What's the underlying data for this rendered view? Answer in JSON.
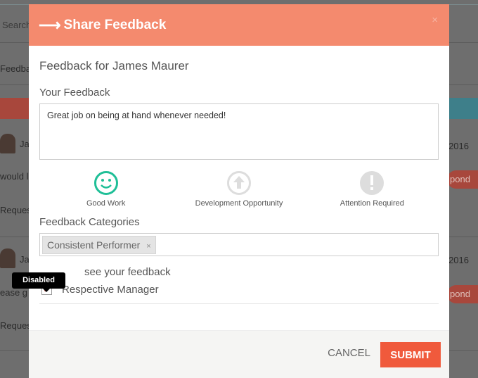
{
  "background": {
    "search": "Search",
    "feedback_tab": "Feedba",
    "rows": [
      {
        "name": "Ja",
        "date": "2016",
        "message": "would li",
        "action": "pond",
        "status": "Reques"
      },
      {
        "name": "Ja",
        "date": "2016",
        "message": "ease g",
        "action": "pond",
        "status": "Reques"
      }
    ]
  },
  "modal": {
    "title": "Share Feedback",
    "close": "×",
    "subtitle": "Feedback for James Maurer",
    "feedback_label": "Your Feedback",
    "feedback_value": "Great job on being at hand whenever needed!",
    "types": [
      {
        "label": "Good Work",
        "icon": "smiley-icon",
        "selected": true,
        "color": "#1fbf97"
      },
      {
        "label": "Development Opportunity",
        "icon": "arrow-up-circle-icon",
        "selected": false
      },
      {
        "label": "Attention Required",
        "icon": "exclamation-circle-icon",
        "selected": false
      }
    ],
    "categories_label": "Feedback Categories",
    "categories": [
      {
        "label": "Consistent Performer",
        "remove": "×"
      }
    ],
    "visibility_label": "see your feedback",
    "tooltip": "Disabled",
    "manager_checkbox": {
      "label": "Respective Manager",
      "checked": true
    },
    "cancel": "CANCEL",
    "submit": "SUBMIT"
  }
}
